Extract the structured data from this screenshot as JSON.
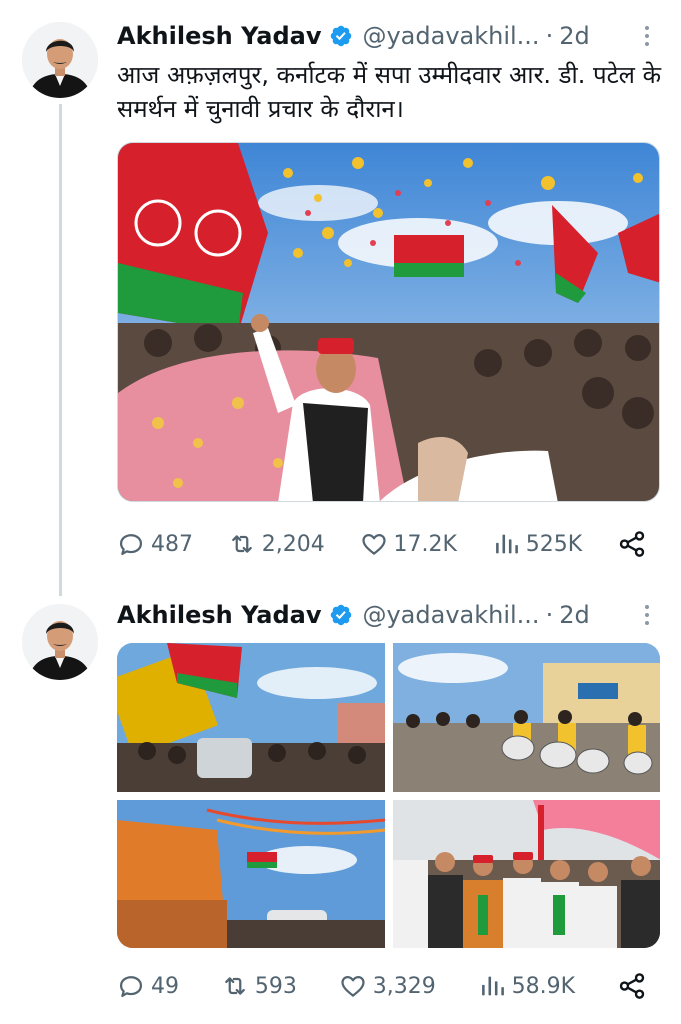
{
  "tweets": [
    {
      "author": "Akhilesh Yadav",
      "handle": "@yadavakhil...",
      "separator": "·",
      "time": "2d",
      "text": "आज अफ़ज़लपुर, कर्नाटक में सपा उम्मीदवार आर. डी. पटेल के समर्थन में चुनावी प्रचार के दौरान।",
      "stats": {
        "replies": "487",
        "reposts": "2,204",
        "likes": "17.2K",
        "views": "525K"
      }
    },
    {
      "author": "Akhilesh Yadav",
      "handle": "@yadavakhil...",
      "separator": "·",
      "time": "2d",
      "text": "",
      "stats": {
        "replies": "49",
        "reposts": "593",
        "likes": "3,329",
        "views": "58.9K"
      }
    }
  ],
  "icons": {
    "verified": "verified-badge-icon",
    "more": "more-vertical-icon",
    "reply": "reply-icon",
    "repost": "repost-icon",
    "like": "heart-icon",
    "views": "views-icon",
    "share": "share-icon"
  },
  "colors": {
    "verified_blue": "#1d9bf0",
    "text_primary": "#0f1419",
    "text_secondary": "#536471",
    "party_red": "#d6202c",
    "party_green": "#1f9a3d",
    "thread_line": "#cfd9de"
  }
}
